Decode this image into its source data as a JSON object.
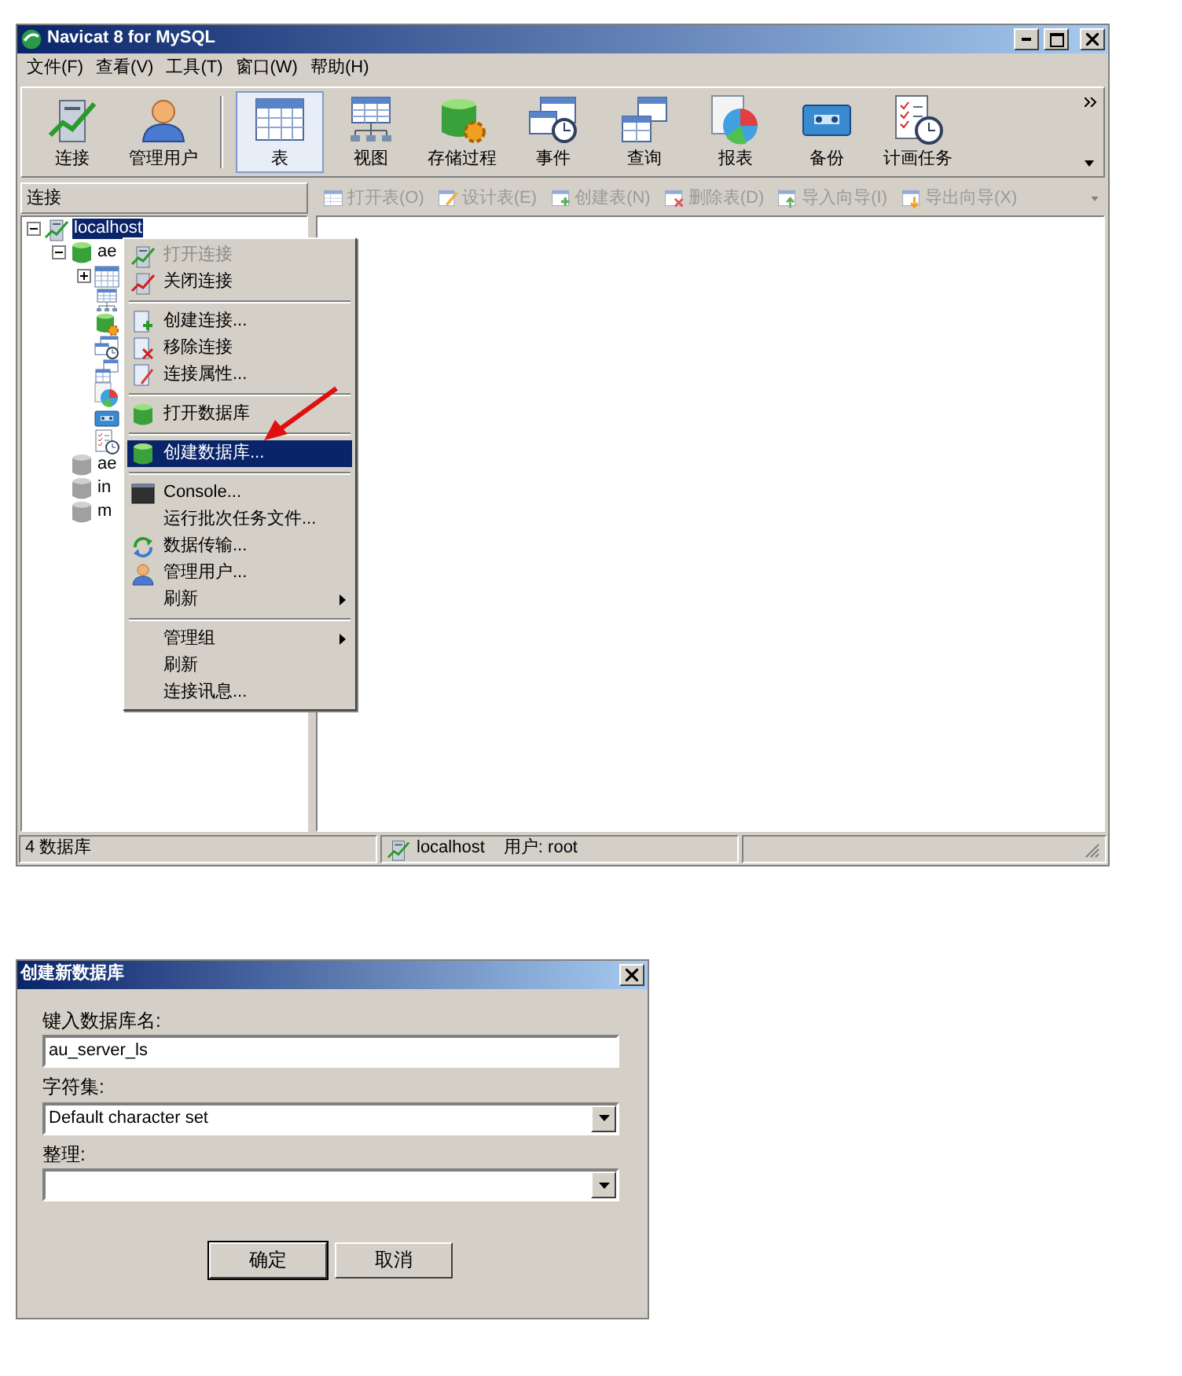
{
  "window": {
    "title": "Navicat 8 for MySQL"
  },
  "menu_bar": [
    "文件(F)",
    "查看(V)",
    "工具(T)",
    "窗口(W)",
    "帮助(H)"
  ],
  "toolbar": {
    "groups": [
      [
        {
          "label": "连接",
          "kind": "connection",
          "selected": false
        },
        {
          "label": "管理用户",
          "kind": "user",
          "selected": false
        }
      ],
      [
        {
          "label": "表",
          "kind": "table",
          "selected": true
        },
        {
          "label": "视图",
          "kind": "view",
          "selected": false
        },
        {
          "label": "存储过程",
          "kind": "procedure",
          "selected": false
        },
        {
          "label": "事件",
          "kind": "event",
          "selected": false
        },
        {
          "label": "查询",
          "kind": "query",
          "selected": false
        },
        {
          "label": "报表",
          "kind": "report",
          "selected": false
        },
        {
          "label": "备份",
          "kind": "backup",
          "selected": false
        },
        {
          "label": "计画任务",
          "kind": "schedule",
          "selected": false
        }
      ]
    ]
  },
  "sidebar": {
    "header": "连接",
    "tree": [
      {
        "label": "localhost",
        "kind": "connection",
        "selected": true,
        "expanded": true,
        "children": [
          {
            "label": "ae",
            "kind": "database",
            "open": true,
            "expanded": true,
            "children": [
              {
                "kind": "table",
                "expandable": true
              },
              {
                "kind": "view"
              },
              {
                "kind": "procedure"
              },
              {
                "kind": "event"
              },
              {
                "kind": "query"
              },
              {
                "kind": "report"
              },
              {
                "kind": "backup"
              },
              {
                "kind": "schedule"
              }
            ]
          },
          {
            "label": "ae",
            "kind": "database",
            "open": false
          },
          {
            "label": "in",
            "kind": "database",
            "open": false
          },
          {
            "label": "m",
            "kind": "database",
            "open": false
          }
        ]
      }
    ]
  },
  "object_toolbar": [
    {
      "label": "打开表(O)",
      "kind": "open",
      "disabled": true
    },
    {
      "label": "设计表(E)",
      "kind": "design",
      "disabled": true
    },
    {
      "label": "创建表(N)",
      "kind": "create",
      "disabled": true
    },
    {
      "label": "删除表(D)",
      "kind": "delete",
      "disabled": true
    },
    {
      "label": "导入向导(I)",
      "kind": "import",
      "disabled": true
    },
    {
      "label": "导出向导(X)",
      "kind": "export",
      "disabled": true
    }
  ],
  "context_menu": [
    {
      "kind": "item",
      "label": "打开连接",
      "disabled": true,
      "selected": false
    },
    {
      "kind": "item",
      "label": "关闭连接",
      "disabled": false,
      "selected": false
    },
    {
      "kind": "separator"
    },
    {
      "kind": "item",
      "label": "创建连接...",
      "disabled": false,
      "selected": false
    },
    {
      "kind": "item",
      "label": "移除连接",
      "disabled": false,
      "selected": false
    },
    {
      "kind": "item",
      "label": "连接属性...",
      "disabled": false,
      "selected": false
    },
    {
      "kind": "separator"
    },
    {
      "kind": "item",
      "label": "打开数据库",
      "disabled": false,
      "selected": false
    },
    {
      "kind": "separator"
    },
    {
      "kind": "item",
      "label": "创建数据库...",
      "disabled": false,
      "selected": true
    },
    {
      "kind": "separator"
    },
    {
      "kind": "item",
      "label": "Console...",
      "disabled": false,
      "selected": false
    },
    {
      "kind": "item",
      "label": "运行批次任务文件...",
      "disabled": false,
      "selected": false
    },
    {
      "kind": "item",
      "label": "数据传输...",
      "disabled": false,
      "selected": false
    },
    {
      "kind": "item",
      "label": "管理用户...",
      "disabled": false,
      "selected": false
    },
    {
      "kind": "item",
      "label": "刷新",
      "disabled": false,
      "selected": false,
      "submenu": true
    },
    {
      "kind": "separator"
    },
    {
      "kind": "item",
      "label": "管理组",
      "disabled": false,
      "selected": false,
      "submenu": true
    },
    {
      "kind": "item",
      "label": "刷新",
      "disabled": false,
      "selected": false
    },
    {
      "kind": "item",
      "label": "连接讯息...",
      "disabled": false,
      "selected": false
    }
  ],
  "status_bar": {
    "count": "4 数据库",
    "connection": "localhost",
    "user": "用户: root"
  },
  "dialog": {
    "title": "创建新数据库",
    "fields": [
      {
        "label": "键入数据库名:",
        "kind": "text",
        "value": "au_server_ls"
      },
      {
        "label": "字符集:",
        "kind": "select",
        "value": "Default character set"
      },
      {
        "label": "整理:",
        "kind": "select"
      }
    ],
    "buttons": [
      {
        "label": "确定",
        "default": true
      },
      {
        "label": "取消",
        "default": false
      }
    ]
  }
}
